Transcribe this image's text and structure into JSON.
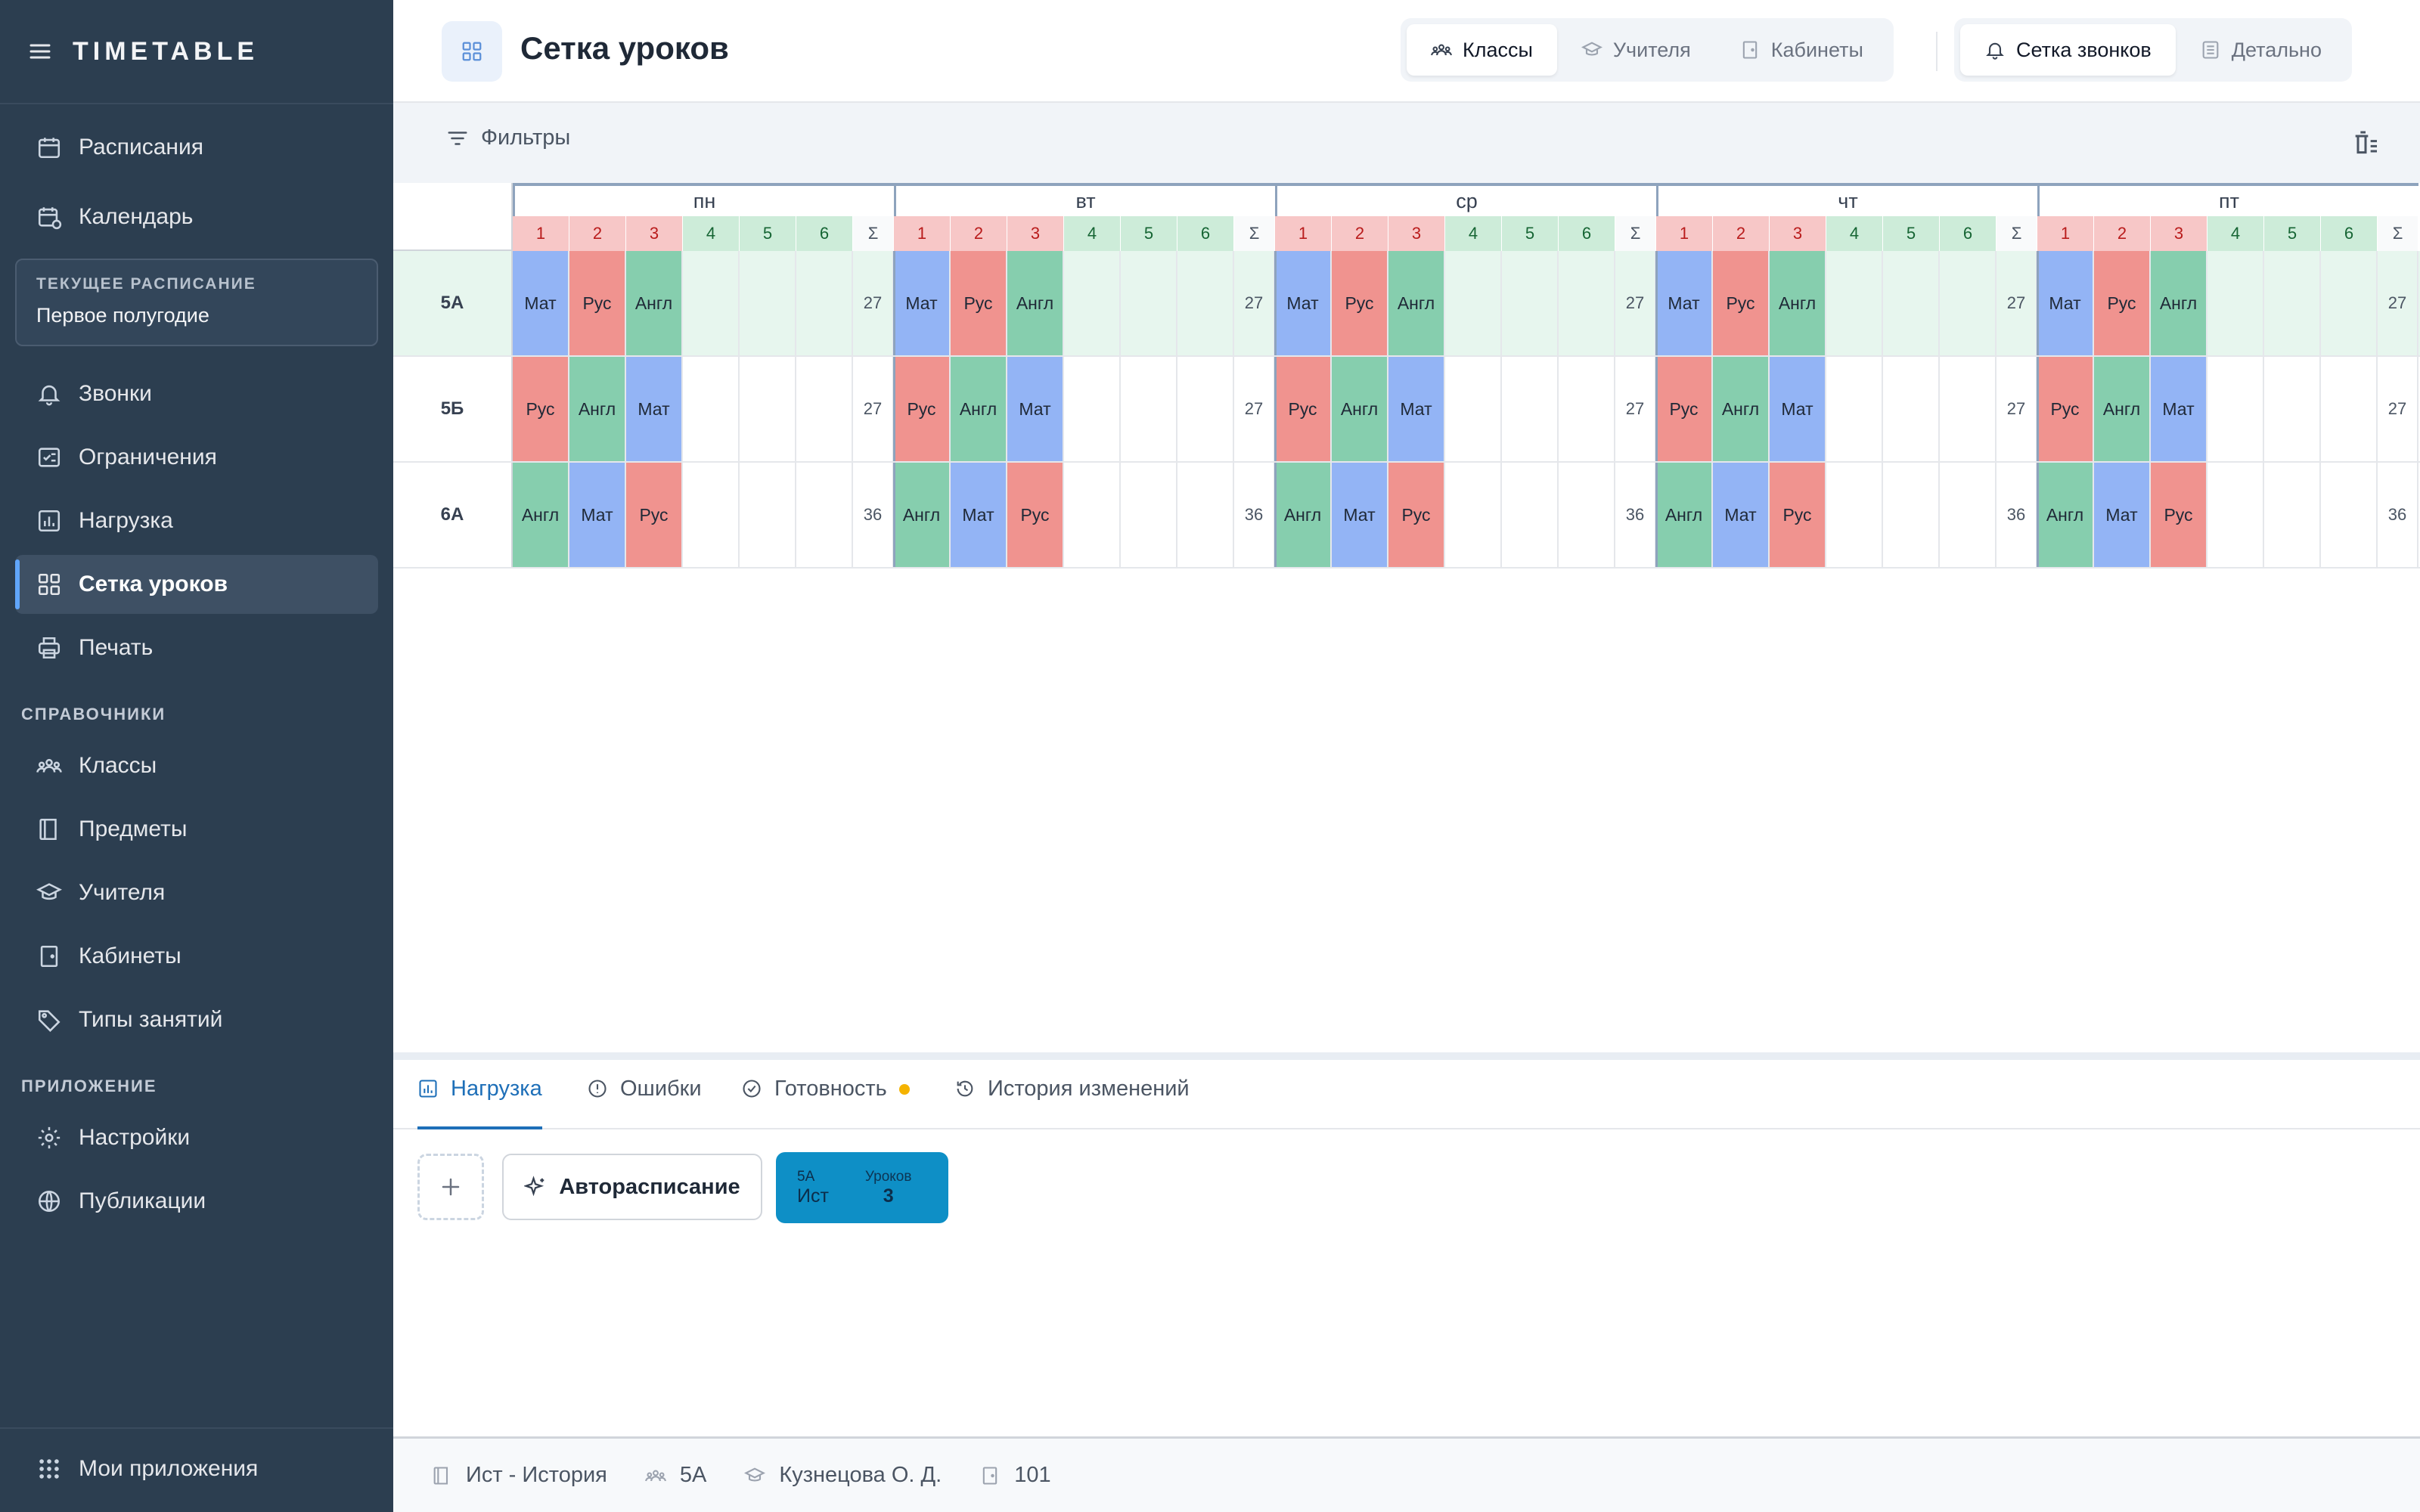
{
  "app": {
    "brand": "TIMETABLE"
  },
  "sidebar": {
    "items_top": [
      {
        "label": "Расписания",
        "icon": "calendar-icon"
      },
      {
        "label": "Календарь",
        "icon": "calendar-clock-icon"
      }
    ],
    "current": {
      "label": "ТЕКУЩЕЕ РАСПИСАНИЕ",
      "value": "Первое полугодие"
    },
    "items_main": [
      {
        "label": "Звонки",
        "icon": "bell-icon"
      },
      {
        "label": "Ограничения",
        "icon": "checklist-icon"
      },
      {
        "label": "Нагрузка",
        "icon": "bar-chart-icon"
      },
      {
        "label": "Сетка уроков",
        "icon": "grid-icon",
        "active": true
      },
      {
        "label": "Печать",
        "icon": "printer-icon"
      }
    ],
    "section_refs": "СПРАВОЧНИКИ",
    "items_refs": [
      {
        "label": "Классы",
        "icon": "users-icon"
      },
      {
        "label": "Предметы",
        "icon": "book-icon"
      },
      {
        "label": "Учителя",
        "icon": "graduation-cap-icon"
      },
      {
        "label": "Кабинеты",
        "icon": "door-icon"
      },
      {
        "label": "Типы занятий",
        "icon": "tag-icon"
      }
    ],
    "section_app": "ПРИЛОЖЕНИЕ",
    "items_app": [
      {
        "label": "Настройки",
        "icon": "gear-icon"
      },
      {
        "label": "Публикации",
        "icon": "globe-icon"
      }
    ],
    "bottom": {
      "label": "Мои приложения",
      "icon": "apps-grid-icon"
    }
  },
  "header": {
    "title": "Сетка уроков",
    "views": [
      "Классы",
      "Учителя",
      "Кабинеты"
    ],
    "active_view": "Классы",
    "modes": [
      "Сетка звонков",
      "Детально"
    ],
    "active_mode": "Сетка звонков"
  },
  "filters": {
    "label": "Фильтры"
  },
  "grid": {
    "days": [
      "пн",
      "вт",
      "ср",
      "чт",
      "пт"
    ],
    "lessons": [
      "1",
      "2",
      "3",
      "4",
      "5",
      "6"
    ],
    "sum_symbol": "Σ",
    "rows": [
      {
        "class": "5А",
        "cells": [
          "Мат",
          "Рус",
          "Англ"
        ],
        "sum": "27",
        "highlight": true
      },
      {
        "class": "5Б",
        "cells": [
          "Рус",
          "Англ",
          "Мат"
        ],
        "sum": "27"
      },
      {
        "class": "6А",
        "cells": [
          "Англ",
          "Мат",
          "Рус"
        ],
        "sum": "36"
      }
    ],
    "subject_colors": {
      "Мат": "#93b4f5",
      "Рус": "#f0938f",
      "Англ": "#86ceae"
    }
  },
  "panel": {
    "tabs": [
      {
        "label": "Нагрузка",
        "icon": "bar-chart-icon",
        "active": true
      },
      {
        "label": "Ошибки",
        "icon": "alert-circle-icon"
      },
      {
        "label": "Готовность",
        "icon": "check-circle-icon",
        "dot": true
      },
      {
        "label": "История изменений",
        "icon": "history-icon"
      }
    ],
    "auto_label": "Авторасписание",
    "card": {
      "class": "5А",
      "subject": "Ист",
      "caption": "Уроков",
      "count": "3"
    }
  },
  "status": {
    "subject": "Ист - История",
    "class": "5А",
    "teacher": "Кузнецова О. Д.",
    "room": "101"
  }
}
